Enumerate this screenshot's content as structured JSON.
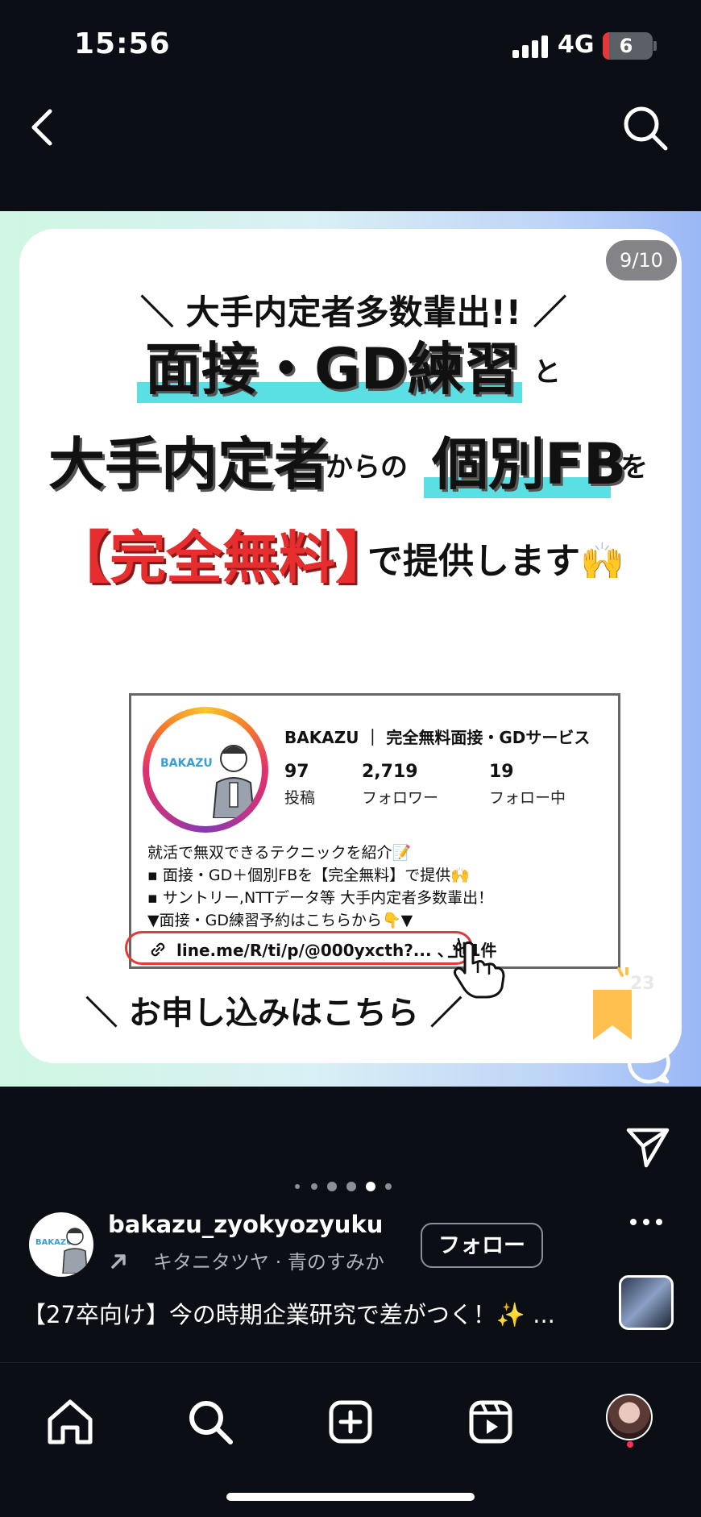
{
  "status_bar": {
    "time": "15:56",
    "network": "4G",
    "battery": "6"
  },
  "post": {
    "counter": "9/10",
    "headline": "＼ 大手内定者多数輩出!! ／",
    "line1_main": "面接・GD練習",
    "line1_suffix": "と",
    "line2_a": "大手内定者",
    "line2_b": "からの",
    "line2_c": "個別FB",
    "line2_d": "を",
    "line3_red": "【完全無料】",
    "line3_rest": "で提供します🙌",
    "profile": {
      "logo": "BAKAZU",
      "name": "BAKAZU ｜ 完全無料面接・GDサービス",
      "stats": [
        {
          "value": "97",
          "label": "投稿"
        },
        {
          "value": "2,719",
          "label": "フォロワー"
        },
        {
          "value": "19",
          "label": "フォロー中"
        }
      ],
      "bio": [
        "就活で無双できるテクニックを紹介📝",
        "▪ 面接・GD＋個別FBを【完全無料】で提供🙌",
        "▪ サントリー,NTTデータ等 大手内定者多数輩出！",
        "▼面接・GD練習予約はこちらから👇▼"
      ],
      "link": "line.me/R/ti/p/@000yxcth?... 、他1件"
    },
    "footer": "＼  お申し込みはこちら  ／"
  },
  "actions": {
    "like_count": "23"
  },
  "author": {
    "username": "bakazu_zyokyozyuku",
    "music": "キタニタツヤ · 青のすみか",
    "follow_label": "フォロー",
    "avatar_logo": "BAKAZU"
  },
  "caption": "【27卒向け】今の時期企業研究で差がつく！✨ ...",
  "pager": {
    "count": 6,
    "active": 4
  },
  "colors": {
    "background": "#0b0f15",
    "highlight": "#5adfe3",
    "red": "#e62e2e",
    "save": "#ffc04d"
  },
  "icons": [
    "back-icon",
    "search-icon",
    "heart-icon",
    "bookmark-icon",
    "comment-icon",
    "send-icon",
    "more-icon",
    "home-icon",
    "create-icon",
    "reels-icon"
  ]
}
